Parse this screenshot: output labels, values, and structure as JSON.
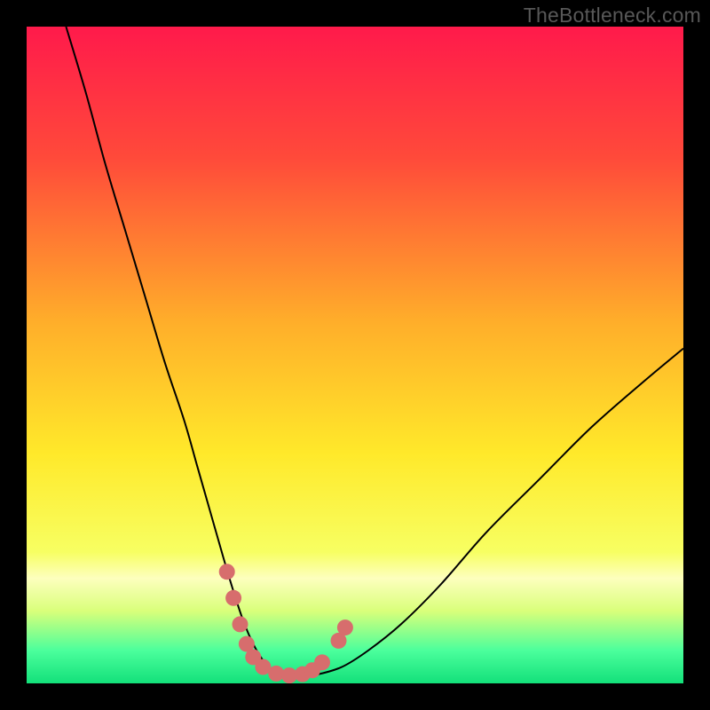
{
  "watermark": "TheBottleneck.com",
  "chart_data": {
    "type": "line",
    "title": "",
    "xlabel": "",
    "ylabel": "",
    "xlim": [
      0,
      100
    ],
    "ylim": [
      0,
      100
    ],
    "gradient_stops": [
      {
        "offset": 0,
        "color": "#ff1a4b"
      },
      {
        "offset": 20,
        "color": "#ff4a3a"
      },
      {
        "offset": 45,
        "color": "#ffae2a"
      },
      {
        "offset": 65,
        "color": "#ffe92a"
      },
      {
        "offset": 80,
        "color": "#f7ff62"
      },
      {
        "offset": 84,
        "color": "#fdffbe"
      },
      {
        "offset": 89,
        "color": "#d9ff7a"
      },
      {
        "offset": 95,
        "color": "#4bff9c"
      },
      {
        "offset": 100,
        "color": "#13e07a"
      }
    ],
    "series": [
      {
        "name": "bottleneck-curve",
        "x": [
          6,
          9,
          12,
          15,
          18,
          21,
          24,
          26,
          28,
          30,
          31.5,
          33,
          34.5,
          36,
          37.5,
          39,
          41,
          44,
          48,
          52,
          57,
          63,
          70,
          78,
          86,
          94,
          100
        ],
        "y": [
          100,
          90,
          79,
          69,
          59,
          49,
          40,
          33,
          26,
          19,
          14,
          9.5,
          6,
          3.5,
          2,
          1.3,
          1,
          1.3,
          2.5,
          5,
          9,
          15,
          23,
          31,
          39,
          46,
          51
        ]
      }
    ],
    "marker_cluster": {
      "name": "trough-markers",
      "color": "#d76d6d",
      "points": [
        {
          "x": 30.5,
          "y": 17
        },
        {
          "x": 31.5,
          "y": 13
        },
        {
          "x": 32.5,
          "y": 9
        },
        {
          "x": 33.5,
          "y": 6
        },
        {
          "x": 34.5,
          "y": 4
        },
        {
          "x": 36,
          "y": 2.5
        },
        {
          "x": 38,
          "y": 1.5
        },
        {
          "x": 40,
          "y": 1.2
        },
        {
          "x": 42,
          "y": 1.4
        },
        {
          "x": 43.5,
          "y": 2
        },
        {
          "x": 45,
          "y": 3.2
        },
        {
          "x": 47.5,
          "y": 6.5
        },
        {
          "x": 48.5,
          "y": 8.5
        }
      ]
    }
  }
}
